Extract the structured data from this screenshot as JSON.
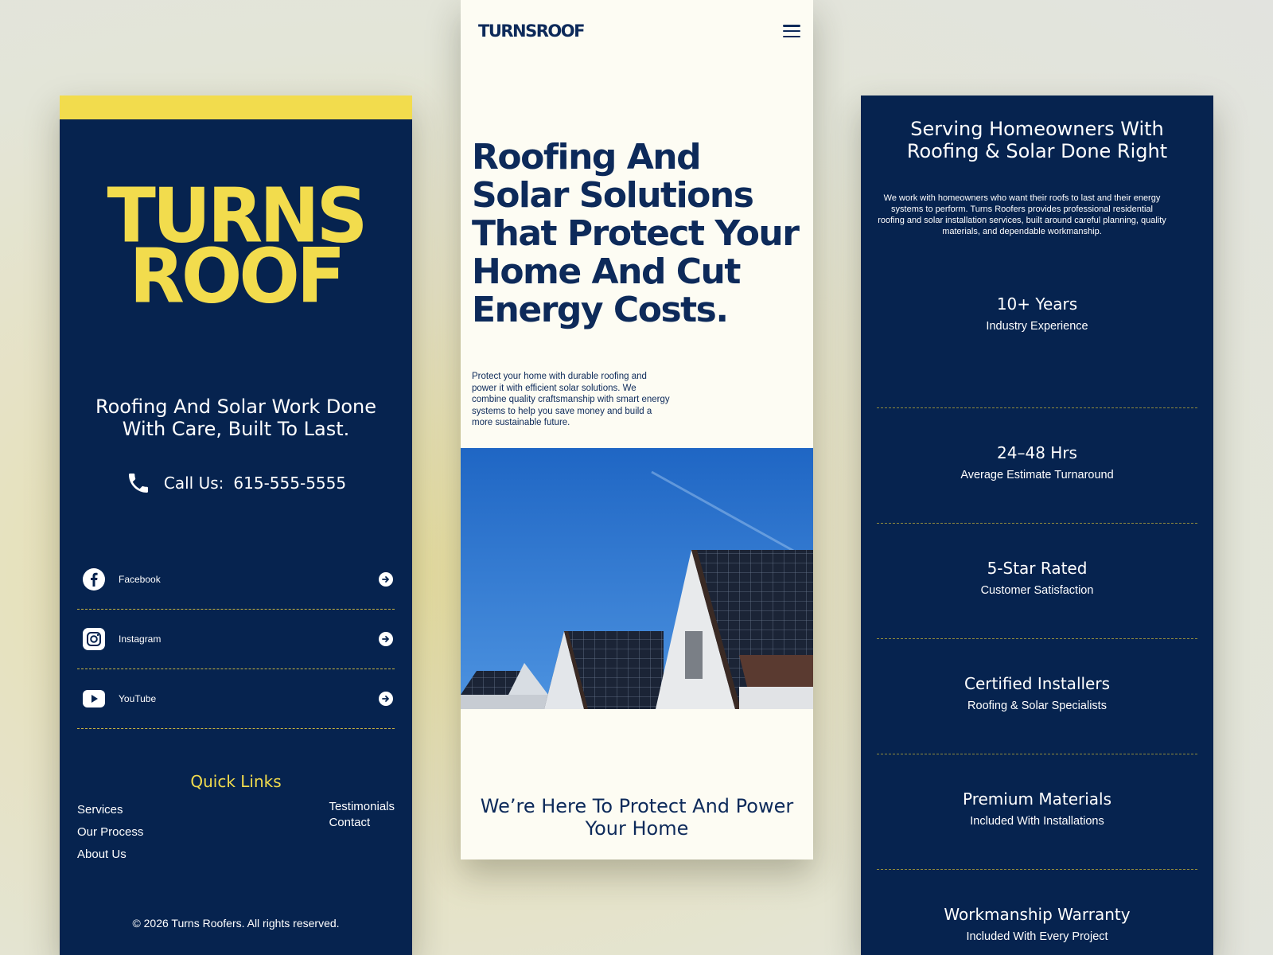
{
  "colors": {
    "navy": "#06234f",
    "yellow": "#f2dc4d",
    "cream": "#fdfcf3",
    "hero_text": "#0d2a5a"
  },
  "left": {
    "logo_line1": "TURNS",
    "logo_line2": "ROOF",
    "tagline": "Roofing And Solar Work Done With Care, Built To Last.",
    "call_label": "Call Us:",
    "phone": "615-555-5555",
    "socials": [
      {
        "label": "Facebook",
        "icon": "facebook-icon"
      },
      {
        "label": "Instagram",
        "icon": "instagram-icon"
      },
      {
        "label": "YouTube",
        "icon": "youtube-icon"
      }
    ],
    "quick_links_title": "Quick Links",
    "quick_links_left": [
      "Services",
      "Our Process",
      "About Us"
    ],
    "quick_links_right": [
      "Testimonials",
      "Contact"
    ],
    "copyright": "© 2026 Turns Roofers. All rights reserved."
  },
  "mid": {
    "logo": "TURNSROOF",
    "menu_icon": "hamburger-icon",
    "hero_title": "Roofing And Solar Solutions That Protect Your Home And Cut Energy Costs.",
    "hero_text": "Protect your home with durable roofing and power it with efficient solar solutions. We combine quality craftsmanship with smart energy systems to help you save money and build a more sustainable future.",
    "bottom_heading": "We’re Here To Protect And Power Your Home"
  },
  "right": {
    "title": "Serving Homeowners With Roofing & Solar Done Right",
    "text": "We work with homeowners who want their roofs to last and their energy systems to perform. Turns Roofers provides professional residential roofing and solar installation services, built around careful planning, quality materials, and dependable workmanship.",
    "stats": [
      {
        "value": "10+ Years",
        "label": "Industry Experience"
      },
      {
        "value": "24–48 Hrs",
        "label": "Average Estimate Turnaround"
      },
      {
        "value": "5-Star Rated",
        "label": "Customer Satisfaction"
      },
      {
        "value": "Certified Installers",
        "label": "Roofing & Solar Specialists"
      },
      {
        "value": "Premium Materials",
        "label": "Included With Installations"
      },
      {
        "value": "Workmanship Warranty",
        "label": "Included With Every Project"
      }
    ]
  }
}
